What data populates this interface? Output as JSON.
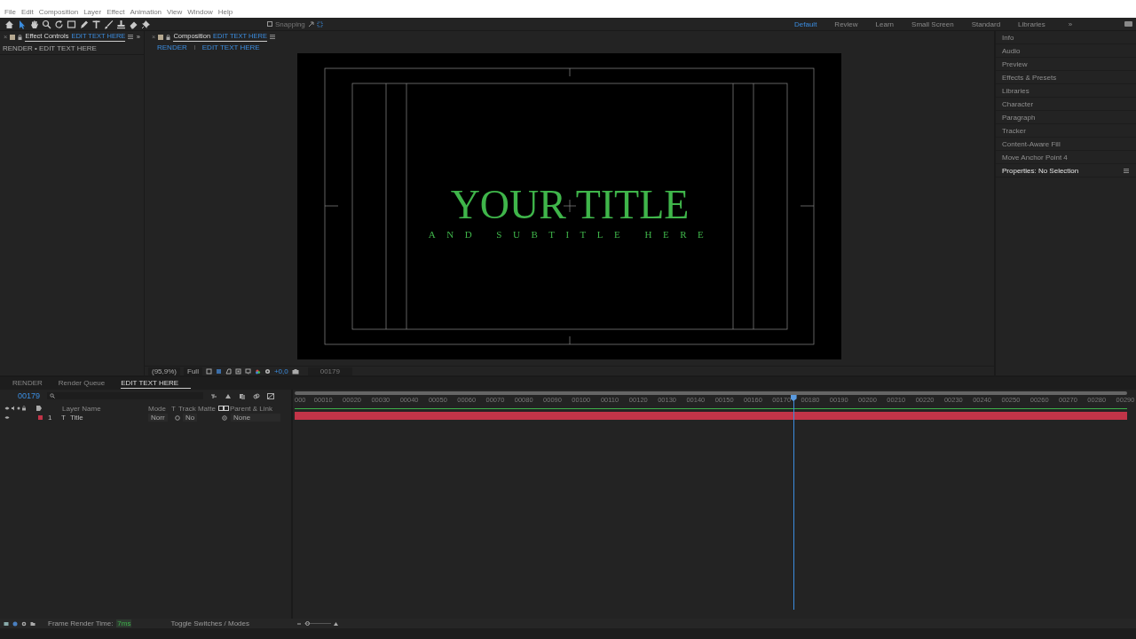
{
  "menu": [
    "File",
    "Edit",
    "Composition",
    "Layer",
    "Effect",
    "Animation",
    "View",
    "Window",
    "Help"
  ],
  "toolbar": {
    "snapping": {
      "label": "Snapping",
      "checked": false
    }
  },
  "workspaces": [
    {
      "label": "Default",
      "selected": true
    },
    {
      "label": "Review",
      "selected": false
    },
    {
      "label": "Learn",
      "selected": false
    },
    {
      "label": "Small Screen",
      "selected": false
    },
    {
      "label": "Standard",
      "selected": false
    },
    {
      "label": "Libraries",
      "selected": false
    }
  ],
  "workspace_more": "»",
  "effect_controls": {
    "close": "×",
    "tab": "Effect Controls",
    "comp": "EDIT TEXT HERE",
    "more": "»",
    "path": "RENDER • EDIT TEXT HERE"
  },
  "composition": {
    "close": "×",
    "tab": "Composition",
    "comp": "EDIT TEXT HERE",
    "breadcrumbs": [
      "RENDER",
      "EDIT TEXT HERE"
    ],
    "title": "YOUR TITLE",
    "subtitle": "AND SUBTITLE HERE",
    "zoom": "(95,9%)",
    "resolution": "Full",
    "exposure": "+0,0",
    "timecode": "00179"
  },
  "panels": [
    "Info",
    "Audio",
    "Preview",
    "Effects & Presets",
    "Libraries",
    "Character",
    "Paragraph",
    "Tracker",
    "Content-Aware Fill",
    "Move Anchor Point 4"
  ],
  "properties_panel": "Properties: No Selection",
  "timeline": {
    "tabs": [
      {
        "label": "RENDER",
        "selected": false
      },
      {
        "label": "Render Queue",
        "selected": false
      },
      {
        "label": "EDIT TEXT HERE",
        "selected": true
      }
    ],
    "timecode": "00179",
    "columns": [
      "Layer Name",
      "Mode",
      "T",
      "Track Matte",
      "Parent & Link"
    ],
    "layers": [
      {
        "number": "1",
        "type": "T",
        "name": "Title",
        "mode": "Norr",
        "matte": "No",
        "parent": "None",
        "color": "#c23448"
      }
    ],
    "ticks": [
      "000",
      "00010",
      "00020",
      "00030",
      "00040",
      "00050",
      "00060",
      "00070",
      "00080",
      "00090",
      "00100",
      "00110",
      "00120",
      "00130",
      "00140",
      "00150",
      "00160",
      "00170",
      "00180",
      "00190",
      "00200",
      "00210",
      "00220",
      "00230",
      "00240",
      "00250",
      "00260",
      "00270",
      "00280",
      "00290"
    ],
    "playhead": {
      "level": 0.6
    }
  },
  "status": {
    "zoom_slider": {
      "level": 0.1
    },
    "frame_render_label": "Frame Render Time:",
    "frame_render_value": "7ms",
    "toggle": "Toggle Switches / Modes"
  }
}
